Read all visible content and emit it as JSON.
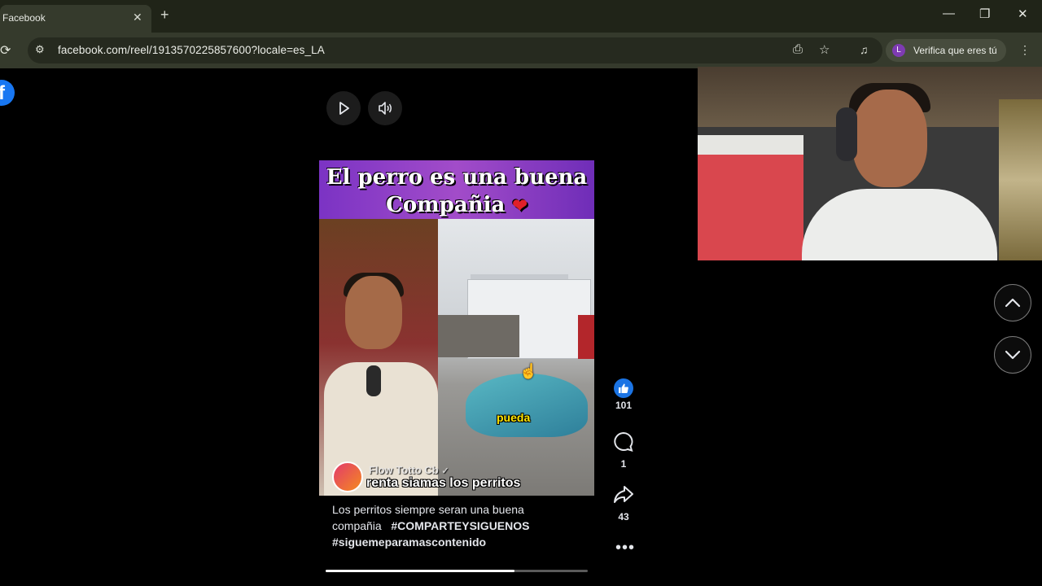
{
  "browser": {
    "tab_title": "Facebook",
    "tab_close": "✕",
    "new_tab": "+",
    "url": "facebook.com/reel/1913570225857600?locale=es_LA",
    "profile_initial": "L",
    "profile_label": "Verifica que eres tú",
    "window_controls": {
      "minimize": "—",
      "restore": "❐",
      "close": "✕"
    },
    "toolbar_icons": [
      "install-app-icon",
      "bookmark-star-icon",
      "media-controls-icon",
      "menu-kebab-icon"
    ]
  },
  "facebook": {
    "logo_letter": "f",
    "reel": {
      "title_line1": "El perro es una buena",
      "title_line2": "Compañia",
      "heart": "❤",
      "overlay_word": "pueda",
      "author": "Flow Totto Cb",
      "verified_mark": "✓",
      "overlay_caption": "renta siamas los perritos",
      "caption_text": "Los perritos siempre seran una buena compañia",
      "hashtag1": "#COMPARTEYSIGUENOS",
      "hashtag2": "#siguemeparamascontenido",
      "progress": 0.72
    },
    "actions": {
      "likes": "101",
      "comments": "1",
      "shares": "43",
      "more": "•••"
    },
    "nav": {
      "prev": "chevron-up-icon",
      "next": "chevron-down-icon"
    }
  },
  "colors": {
    "fb_blue": "#1877f2",
    "like_blue": "#1b74e4",
    "chrome_bg": "#202418"
  }
}
